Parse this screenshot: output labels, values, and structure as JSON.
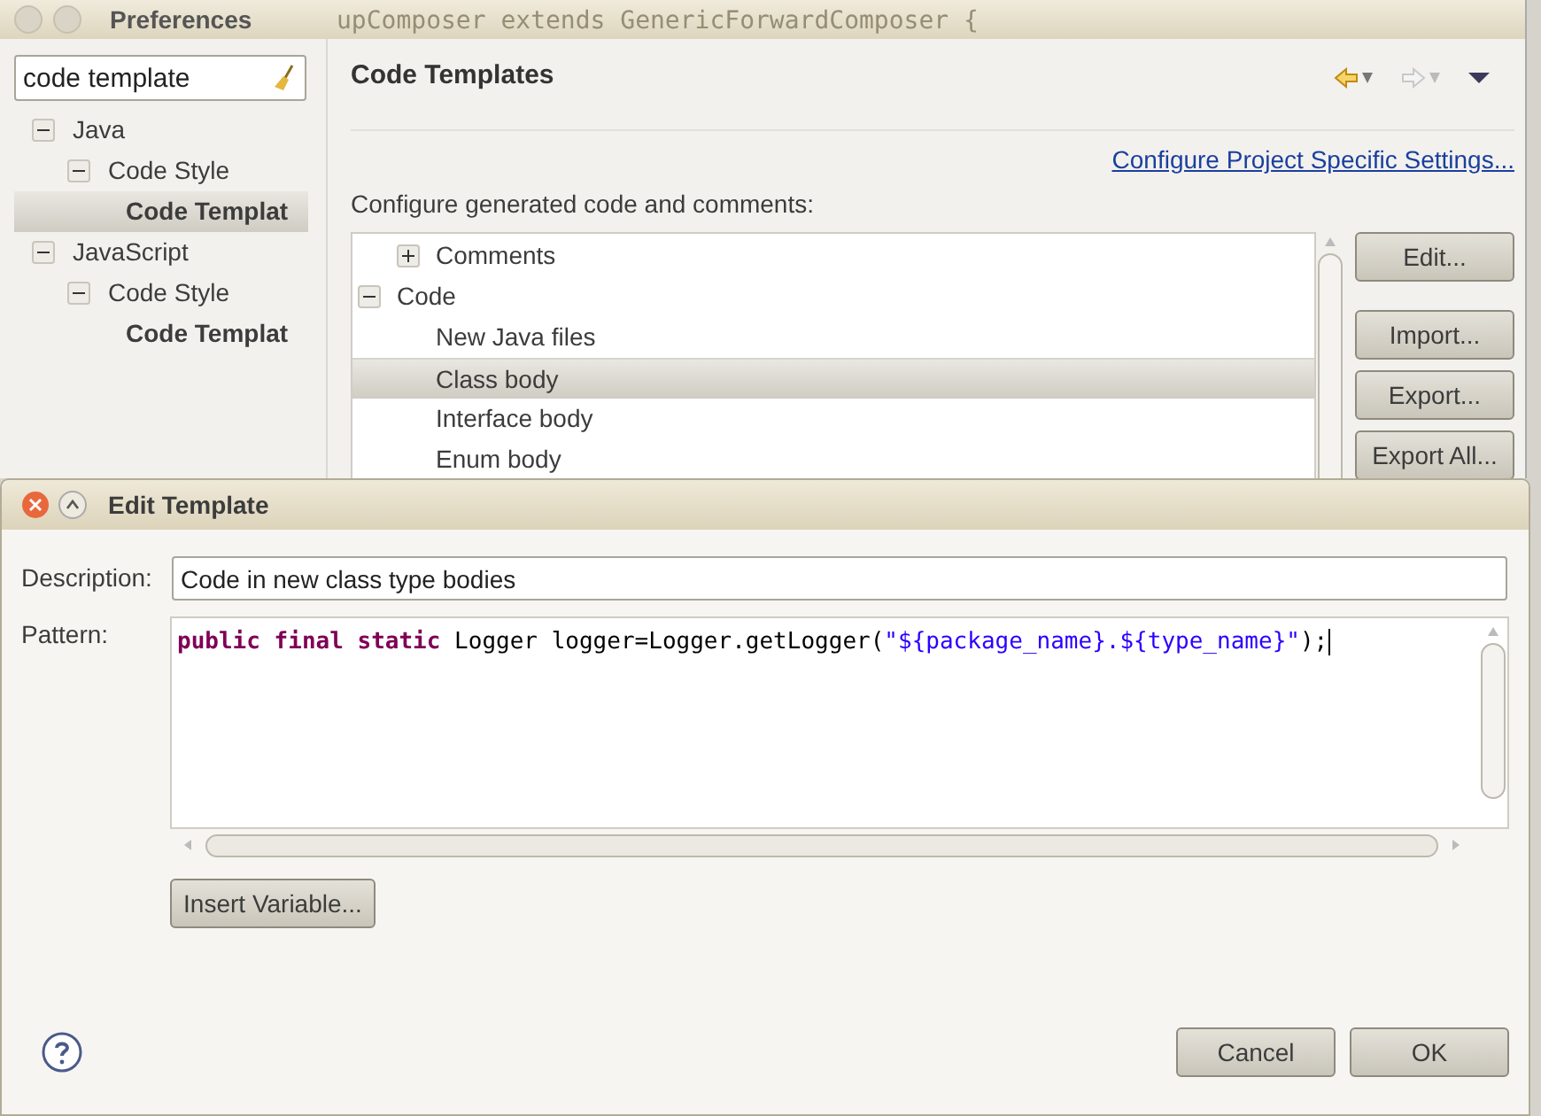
{
  "background_editor": {
    "code_fragment": "upComposer extends GenericForwardComposer {"
  },
  "preferences": {
    "title": "Preferences",
    "filter": {
      "value": "code template"
    },
    "tree": [
      {
        "label": "Java",
        "expanded": true,
        "selected": false,
        "children": [
          {
            "label": "Code Style",
            "expanded": true,
            "selected": false,
            "children": [
              {
                "label": "Code Templat",
                "selected": true,
                "bold": true
              }
            ]
          }
        ]
      },
      {
        "label": "JavaScript",
        "expanded": true,
        "selected": false,
        "children": [
          {
            "label": "Code Style",
            "expanded": true,
            "selected": false,
            "children": [
              {
                "label": "Code Templat",
                "selected": false,
                "bold": true
              }
            ]
          }
        ]
      }
    ],
    "page_title": "Code Templates",
    "link": "Configure Project Specific Settings...",
    "instructions": "Configure generated code and comments:",
    "templates": [
      {
        "label": "Comments",
        "expanded": false,
        "selected": false
      },
      {
        "label": "Code",
        "expanded": true,
        "selected": false,
        "children": [
          {
            "label": "New Java files",
            "selected": false
          },
          {
            "label": "Class body",
            "selected": true
          },
          {
            "label": "Interface body",
            "selected": false
          },
          {
            "label": "Enum body",
            "selected": false
          }
        ]
      }
    ],
    "buttons": [
      {
        "label": "Edit..."
      },
      {
        "label": "Import..."
      },
      {
        "label": "Export..."
      },
      {
        "label": "Export All..."
      }
    ]
  },
  "edit_template": {
    "title": "Edit Template",
    "description_label": "Description:",
    "description": "Code in new class type bodies",
    "pattern_label": "Pattern:",
    "pattern": [
      {
        "kind": "keyword",
        "text": "public final static"
      },
      {
        "kind": "plain",
        "text": " Logger logger=Logger.getLogger("
      },
      {
        "kind": "string",
        "text": "\"${package_name}.${type_name}\""
      },
      {
        "kind": "plain",
        "text": ");"
      }
    ],
    "insert_button": "Insert Variable...",
    "buttons": [
      "Cancel",
      "OK"
    ]
  }
}
